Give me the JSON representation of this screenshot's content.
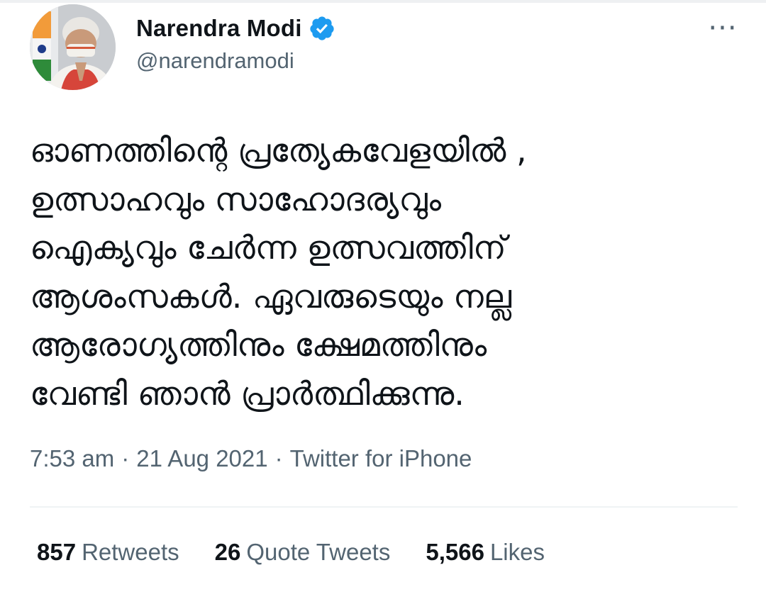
{
  "tweet": {
    "author": {
      "display_name": "Narendra Modi",
      "handle": "@narendramodi",
      "verified": true
    },
    "text": "ഓണത്തിന്റെ പ്രത്യേകവേളയിൽ ,\nഉത്സാഹവും സാഹോദര്യവും\nഐക്യവും ചേർന്ന ഉത്സവത്തിന്\nആശംസകൾ. ഏവരുടെയും നല്ല\nആരോഗ്യത്തിനും ക്ഷേമത്തിനും\nവേണ്ടി ഞാൻ പ്രാർത്ഥിക്കുന്നു.",
    "time": "7:53 am",
    "date": "21 Aug 2021",
    "source": "Twitter for iPhone",
    "separator": "·",
    "more_icon": "···",
    "stats": {
      "retweets": {
        "count": "857",
        "label": "Retweets"
      },
      "quotes": {
        "count": "26",
        "label": "Quote Tweets"
      },
      "likes": {
        "count": "5,566",
        "label": "Likes"
      }
    }
  },
  "colors": {
    "text_primary": "#0f1419",
    "text_secondary": "#536471",
    "verified_blue": "#1d9bf0",
    "divider": "#eff3f4"
  },
  "icons": {
    "verified": "verified-badge-icon",
    "more": "more-horizontal-icon"
  }
}
